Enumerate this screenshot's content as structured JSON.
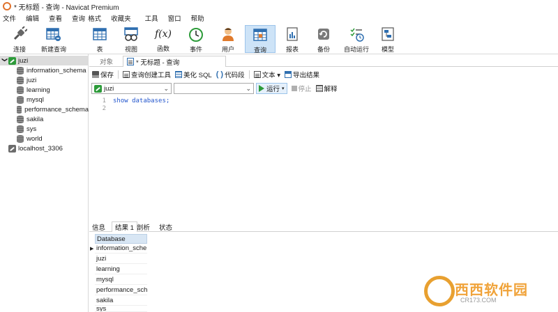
{
  "window": {
    "title": "* 无标题 - 查询 - Navicat Premium"
  },
  "menu": [
    "文件",
    "编辑",
    "查看",
    "查询",
    "格式",
    "收藏夹",
    "工具",
    "窗口",
    "帮助"
  ],
  "toolbar": {
    "items": [
      {
        "label": "连接",
        "icon": "plug-icon"
      },
      {
        "label": "新建查询",
        "icon": "new-query-icon"
      },
      {
        "label": "表",
        "icon": "table-icon"
      },
      {
        "label": "视图",
        "icon": "view-icon"
      },
      {
        "label": "函数",
        "icon": "function-icon"
      },
      {
        "label": "事件",
        "icon": "clock-icon"
      },
      {
        "label": "用户",
        "icon": "user-icon"
      },
      {
        "label": "查询",
        "icon": "query-icon"
      },
      {
        "label": "报表",
        "icon": "report-icon"
      },
      {
        "label": "备份",
        "icon": "backup-icon"
      },
      {
        "label": "自动运行",
        "icon": "autorun-icon"
      },
      {
        "label": "模型",
        "icon": "model-icon"
      }
    ],
    "function_glyph": "f(x)",
    "active": "查询"
  },
  "sidebar": {
    "connection": "juzi",
    "databases": [
      "information_schema",
      "juzi",
      "learning",
      "mysql",
      "performance_schema",
      "sakila",
      "sys",
      "world"
    ],
    "other_connection": "localhost_3306",
    "expander": "❯"
  },
  "tabs": {
    "objects": "对象",
    "query": "* 无标题 - 查询"
  },
  "query_toolbar": {
    "save": "保存",
    "query_builder": "查询创建工具",
    "beautify": "美化 SQL",
    "code_snippet": "代码段",
    "text": "文本 ▾",
    "export": "导出结果"
  },
  "query_controls": {
    "connection_value": "juzi",
    "database_value": "",
    "run": "运行",
    "stop": "停止",
    "explain": "解释"
  },
  "editor": {
    "lines": [
      {
        "no": "1",
        "code": "show databases;"
      },
      {
        "no": "2",
        "code": ""
      }
    ]
  },
  "result_tabs": [
    "信息",
    "结果 1",
    "剖析",
    "状态"
  ],
  "result": {
    "column": "Database",
    "rows": [
      "information_schema",
      "juzi",
      "learning",
      "mysql",
      "performance_schema",
      "sakila",
      "sys"
    ]
  },
  "watermark": {
    "brand": "西西软件园",
    "sub": "CR173.COM"
  }
}
